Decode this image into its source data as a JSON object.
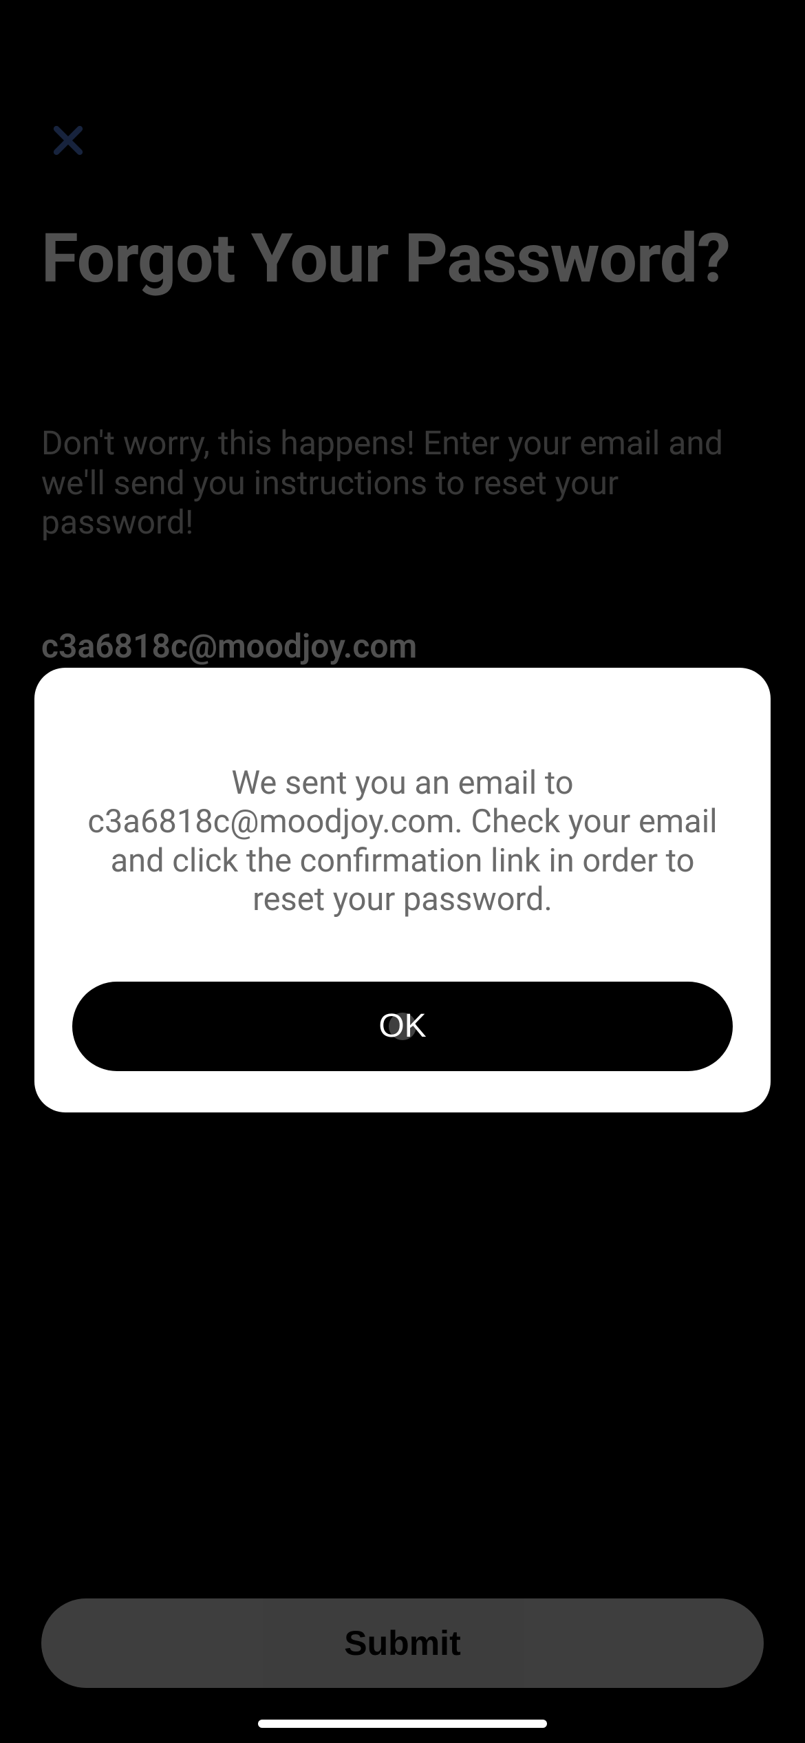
{
  "page": {
    "title": "Forgot Your Password?",
    "subtitle": "Don't worry, this happens! Enter your email and we'll send you instructions to reset your password!",
    "email_value": "c3a6818c@moodjoy.com",
    "submit_label": "Submit"
  },
  "modal": {
    "message": "We sent you an email to c3a6818c@moodjoy.com. Check your email and click the confirmation link in order to reset your password.",
    "ok_label": "OK"
  }
}
